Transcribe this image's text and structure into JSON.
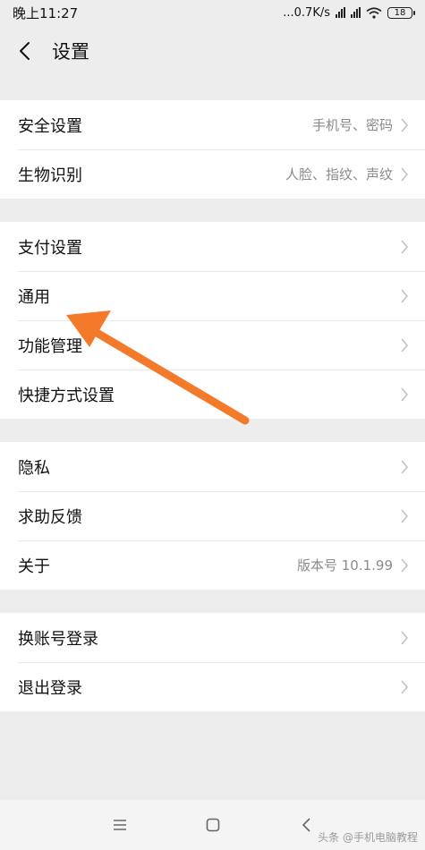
{
  "status": {
    "time": "晚上11:27",
    "network": "...0.7K/s",
    "battery": "18"
  },
  "header": {
    "title": "设置"
  },
  "groups": [
    {
      "items": [
        {
          "label": "安全设置",
          "value": "手机号、密码"
        },
        {
          "label": "生物识别",
          "value": "人脸、指纹、声纹"
        }
      ]
    },
    {
      "items": [
        {
          "label": "支付设置",
          "value": ""
        },
        {
          "label": "通用",
          "value": ""
        },
        {
          "label": "功能管理",
          "value": ""
        },
        {
          "label": "快捷方式设置",
          "value": ""
        }
      ]
    },
    {
      "items": [
        {
          "label": "隐私",
          "value": ""
        },
        {
          "label": "求助反馈",
          "value": ""
        },
        {
          "label": "关于",
          "value": "版本号 10.1.99"
        }
      ]
    },
    {
      "items": [
        {
          "label": "换账号登录",
          "value": ""
        },
        {
          "label": "退出登录",
          "value": ""
        }
      ]
    }
  ],
  "watermark": "头条 @手机电脑教程",
  "colors": {
    "accent_arrow": "#f47a2b",
    "chevron": "#c2c2c2",
    "background": "#ededed"
  }
}
